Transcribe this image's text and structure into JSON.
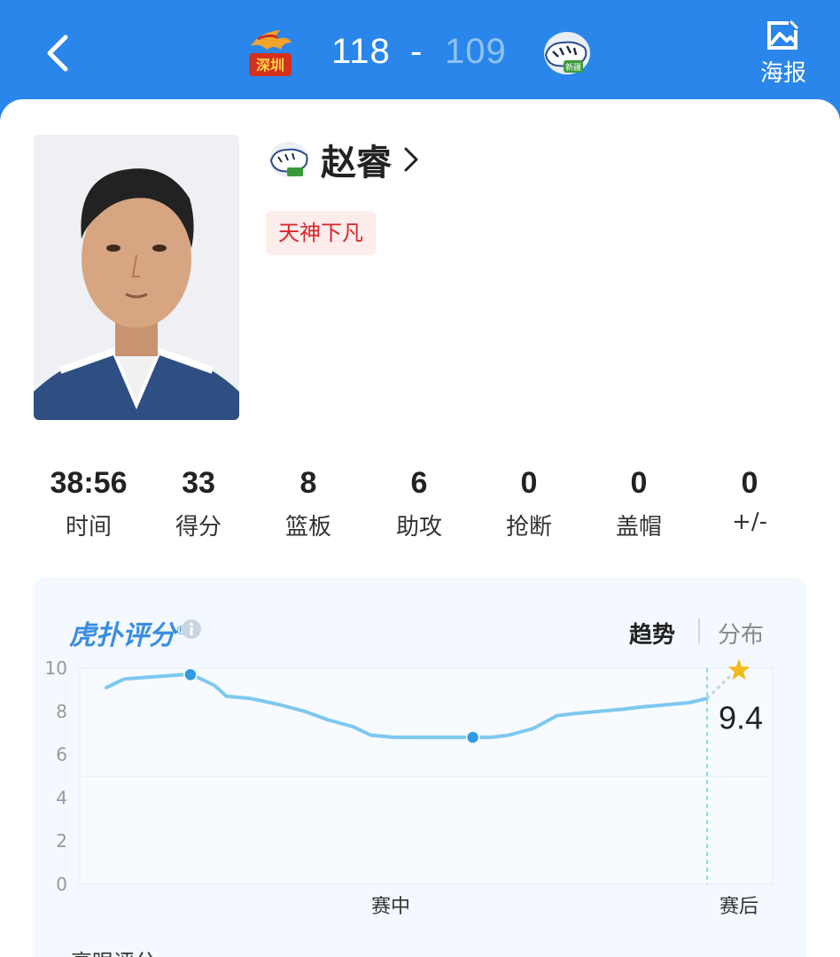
{
  "header": {
    "home_team_icon": "shenzhen-team-logo",
    "away_team_icon": "xinjiang-tigers-logo",
    "home_score": "118",
    "separator": "-",
    "away_score": "109",
    "poster_label": "海报",
    "colors": {
      "bar": "#2a86ea",
      "away_score": "#8fc2f5"
    }
  },
  "player": {
    "name": "赵睿",
    "tag": "天神下凡",
    "team_icon": "xinjiang-tigers-logo"
  },
  "stats": [
    {
      "value": "38:56",
      "label": "时间"
    },
    {
      "value": "33",
      "label": "得分"
    },
    {
      "value": "8",
      "label": "篮板"
    },
    {
      "value": "6",
      "label": "助攻"
    },
    {
      "value": "0",
      "label": "抢断"
    },
    {
      "value": "0",
      "label": "盖帽"
    },
    {
      "value": "0",
      "label": "+/-"
    }
  ],
  "rating": {
    "brand": "虎扑评分",
    "brand_mark": "®",
    "tab_trend": "趋势",
    "tab_distribution": "分布",
    "final_score": "9.4",
    "footer_label": "亮眼评分"
  },
  "chart_data": {
    "type": "line",
    "y_ticks": [
      "10",
      "8",
      "6",
      "4",
      "2",
      "0"
    ],
    "x_labels": [
      "赛中",
      "赛后"
    ],
    "ylim": [
      0,
      10
    ],
    "line_color": "#7ec8ee",
    "marker_color": "#2f9ae6",
    "grid": true,
    "series": [
      {
        "x": [
          0,
          0.03,
          0.08,
          0.13,
          0.15,
          0.18,
          0.2,
          0.24,
          0.29,
          0.33,
          0.37,
          0.41,
          0.44,
          0.48,
          0.52,
          0.56,
          0.6,
          0.64,
          0.67,
          0.71,
          0.75,
          0.78,
          0.82,
          0.86,
          0.89,
          0.93,
          0.97,
          1.0
        ],
        "y": [
          9.1,
          9.5,
          9.6,
          9.7,
          9.6,
          9.2,
          8.7,
          8.6,
          8.3,
          8.0,
          7.6,
          7.3,
          6.9,
          6.8,
          6.8,
          6.8,
          6.8,
          6.8,
          6.9,
          7.2,
          7.8,
          7.9,
          8.0,
          8.1,
          8.2,
          8.3,
          8.4,
          8.6
        ]
      }
    ],
    "markers": [
      {
        "x": 0.14,
        "y": 9.7
      },
      {
        "x": 0.61,
        "y": 6.8
      }
    ],
    "final": {
      "y": 9.4,
      "label": "9.4"
    }
  }
}
